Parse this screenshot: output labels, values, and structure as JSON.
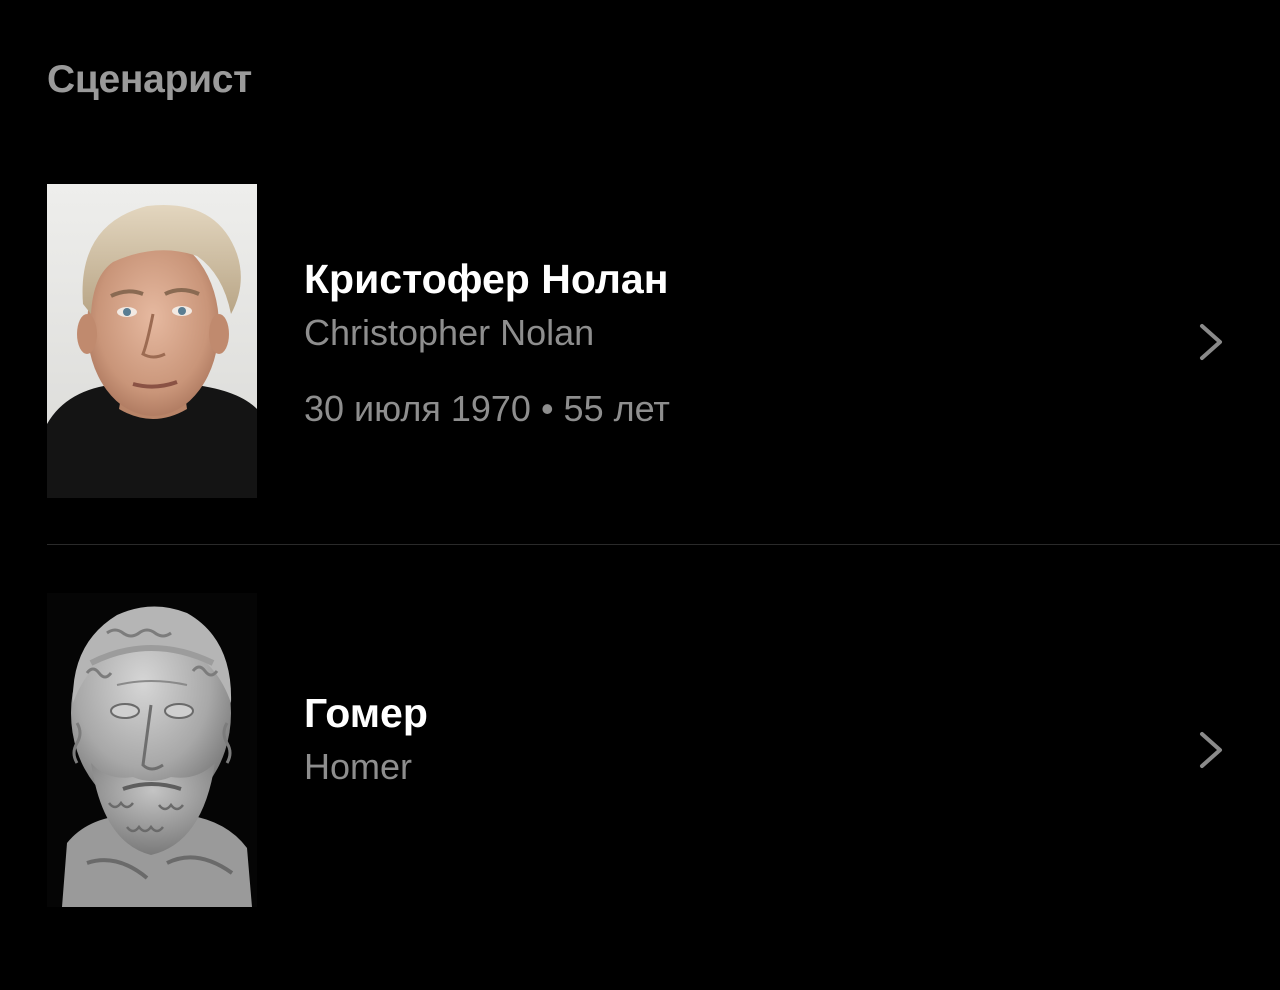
{
  "section": {
    "title": "Сценарист"
  },
  "people": [
    {
      "name": "Кристофер Нолан",
      "original_name": "Christopher Nolan",
      "birth_info": "30 июля 1970 • 55 лет",
      "photo_icon": "portrait-photo",
      "chevron_icon": "chevron-right-icon"
    },
    {
      "name": "Гомер",
      "original_name": "Homer",
      "photo_icon": "bust-photo",
      "chevron_icon": "chevron-right-icon"
    }
  ],
  "colors": {
    "background": "#000000",
    "title": "#9a9a9a",
    "name": "#ffffff",
    "secondary": "#8e8e8e",
    "chevron": "#8a8a8a",
    "divider": "#2a2a2a"
  }
}
